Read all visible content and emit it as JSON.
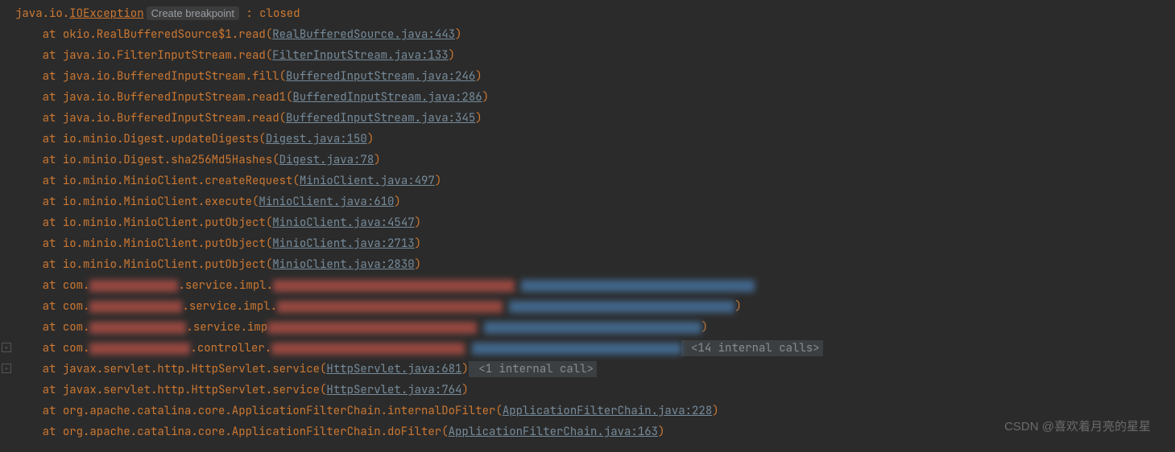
{
  "exception": {
    "prefix": "java.io.",
    "class": "IOException",
    "create_breakpoint": "Create breakpoint",
    "colon": " : ",
    "message": "closed"
  },
  "at": "at ",
  "indent_root": "",
  "indent_frame": "    ",
  "open": "(",
  "close": ")",
  "frames": [
    {
      "call": "okio.RealBufferedSource$1.read",
      "link": "RealBufferedSource.java:443"
    },
    {
      "call": "java.io.FilterInputStream.read",
      "link": "FilterInputStream.java:133"
    },
    {
      "call": "java.io.BufferedInputStream.fill",
      "link": "BufferedInputStream.java:246"
    },
    {
      "call": "java.io.BufferedInputStream.read1",
      "link": "BufferedInputStream.java:286"
    },
    {
      "call": "java.io.BufferedInputStream.read",
      "link": "BufferedInputStream.java:345"
    },
    {
      "call": "io.minio.Digest.updateDigests",
      "link": "Digest.java:150"
    },
    {
      "call": "io.minio.Digest.sha256Md5Hashes",
      "link": "Digest.java:78"
    },
    {
      "call": "io.minio.MinioClient.createRequest",
      "link": "MinioClient.java:497"
    },
    {
      "call": "io.minio.MinioClient.execute",
      "link": "MinioClient.java:610"
    },
    {
      "call": "io.minio.MinioClient.putObject",
      "link": "MinioClient.java:4547"
    },
    {
      "call": "io.minio.MinioClient.putObject",
      "link": "MinioClient.java:2713"
    },
    {
      "call": "io.minio.MinioClient.putObject",
      "link": "MinioClient.java:2830"
    }
  ],
  "redacted": [
    {
      "prefix": "com.",
      "mid": ".service.impl.",
      "redParen": false,
      "trailParen": false
    },
    {
      "prefix": "com.",
      "mid": ".service.impl.",
      "redParen": false,
      "trailParen": true
    },
    {
      "prefix": "com.",
      "mid": ".service.imp",
      "redParen": false,
      "trailParen": true
    },
    {
      "prefix": "com.",
      "mid": ".controller.",
      "redParen": false,
      "trailParen": false,
      "after": " <14 internal calls>",
      "afterType": "internal",
      "gutter": true
    }
  ],
  "after_redacted": [
    {
      "call": "javax.servlet.http.HttpServlet.service",
      "link": "HttpServlet.java:681",
      "suffix": " <1 internal call>",
      "suffixType": "internal",
      "gutter": true
    },
    {
      "call": "javax.servlet.http.HttpServlet.service",
      "link": "HttpServlet.java:764"
    },
    {
      "call": "org.apache.catalina.core.ApplicationFilterChain.internalDoFilter",
      "link": "ApplicationFilterChain.java:228"
    },
    {
      "call": "org.apache.catalina.core.ApplicationFilterChain.doFilter",
      "link": "ApplicationFilterChain.java:163"
    }
  ],
  "watermark": "CSDN @喜欢着月亮的星星"
}
